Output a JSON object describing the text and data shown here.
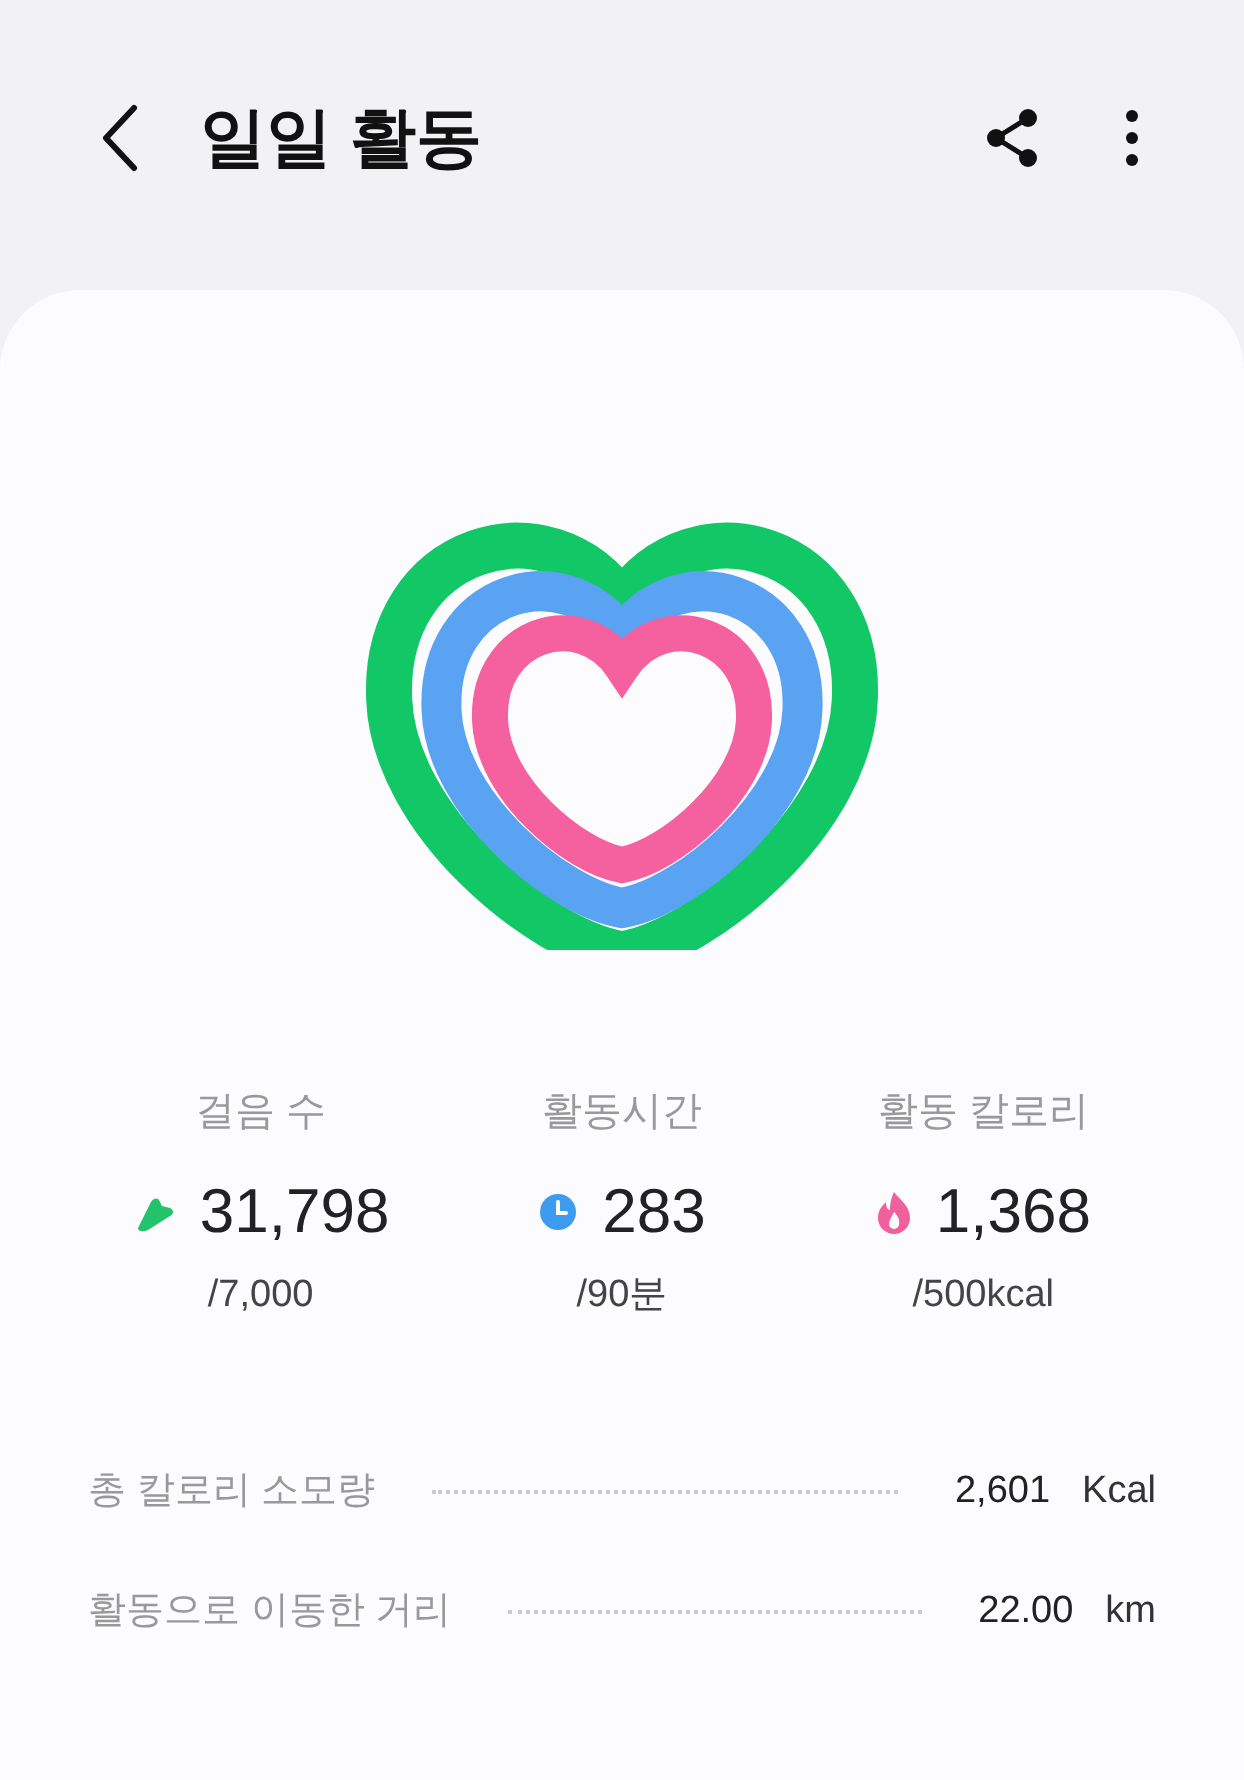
{
  "header": {
    "title": "일일 활동"
  },
  "stats": [
    {
      "kind": "steps",
      "label": "걸음 수",
      "value": "31,798",
      "goal": "/7,000",
      "color": "#22c36a"
    },
    {
      "kind": "time",
      "label": "활동시간",
      "value": "283",
      "goal": "/90분",
      "color": "#3d9bf0"
    },
    {
      "kind": "calories",
      "label": "활동 칼로리",
      "value": "1,368",
      "goal": "/500kcal",
      "color": "#f0609c"
    }
  ],
  "summary": [
    {
      "label": "총 칼로리 소모량",
      "value": "2,601",
      "unit": "Kcal"
    },
    {
      "label": "활동으로 이동한 거리",
      "value": "22.00",
      "unit": "km"
    }
  ]
}
